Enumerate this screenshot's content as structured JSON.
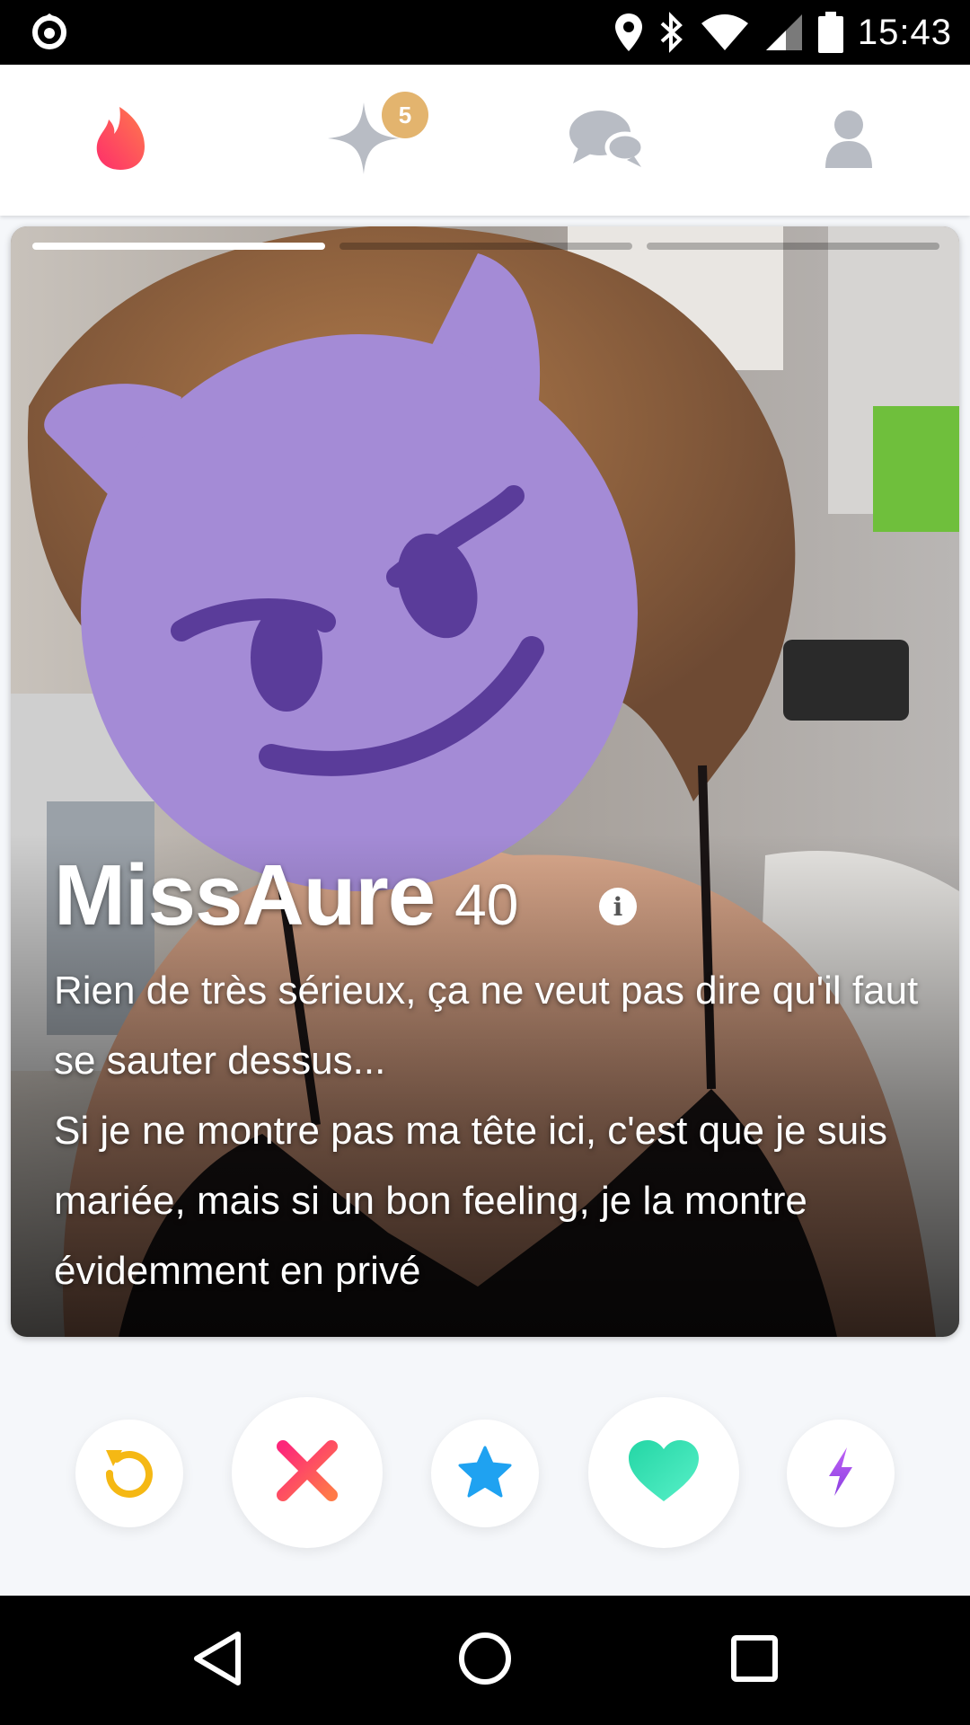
{
  "status_bar": {
    "time": "15:43",
    "icons": [
      "app-notification-icon",
      "location-icon",
      "bluetooth-icon",
      "wifi-icon",
      "cell-signal-icon",
      "battery-icon"
    ]
  },
  "top_nav": {
    "tabs": [
      {
        "name": "discover",
        "icon": "flame-icon",
        "active": true
      },
      {
        "name": "top-picks",
        "icon": "sparkle-icon",
        "badge": "5"
      },
      {
        "name": "messages",
        "icon": "chat-bubbles-icon"
      },
      {
        "name": "profile",
        "icon": "person-icon"
      }
    ],
    "colors": {
      "active": "#fd4d6a",
      "inactive": "#b8bcc4",
      "badge": "#e3b46e"
    }
  },
  "card": {
    "photo_count": 3,
    "current_photo": 1,
    "name": "MissAure",
    "age": "40",
    "bio_lines": [
      "Rien de très sérieux, ça ne veut pas dire qu'il faut se sauter dessus...",
      "Si je ne montre pas ma tête ici, c'est que je suis mariée, mais si un bon feeling, je la montre évidemment en privé"
    ],
    "face_cover": "smiling-devil-emoji"
  },
  "actions": [
    {
      "name": "rewind-button",
      "icon": "rewind-icon",
      "color": "#f5b814"
    },
    {
      "name": "nope-button",
      "icon": "x-icon",
      "color": "#fd5068"
    },
    {
      "name": "super-like-button",
      "icon": "star-icon",
      "color": "#1fa2f1"
    },
    {
      "name": "like-button",
      "icon": "heart-icon",
      "color": "#35e3b4"
    },
    {
      "name": "boost-button",
      "icon": "bolt-icon",
      "color": "#a350ee"
    }
  ],
  "nav_bar": {
    "icons": [
      "back-icon",
      "home-icon",
      "recents-icon"
    ]
  }
}
